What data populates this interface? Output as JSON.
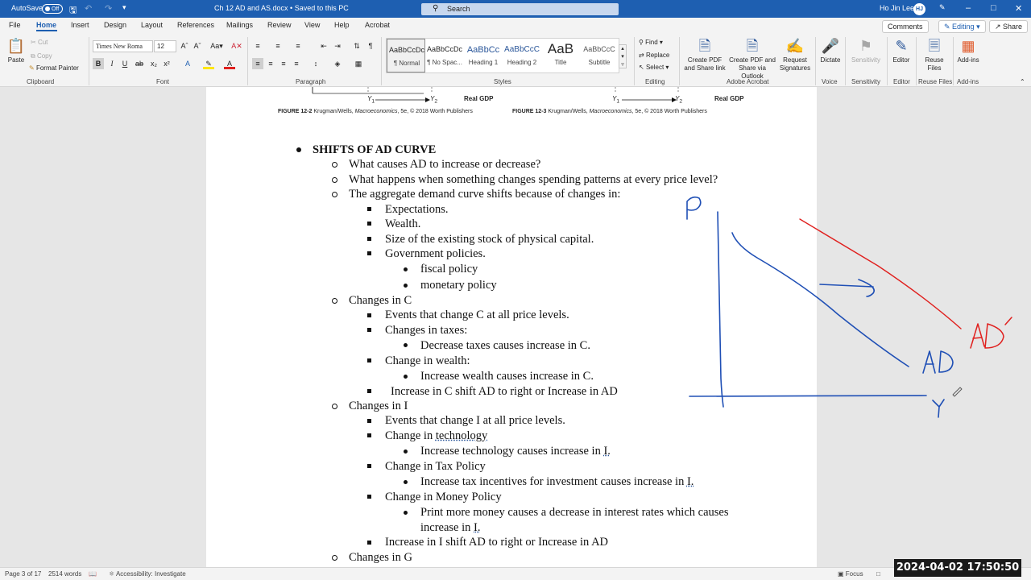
{
  "titlebar": {
    "autosave_label": "AutoSave",
    "autosave_state": "Off",
    "doc_title": "Ch 12 AD and AS.docx • Saved to this PC",
    "search_placeholder": "Search",
    "user_name": "Ho Jin Lee",
    "user_initials": "HJ",
    "icons": [
      "save-icon",
      "undo-icon",
      "redo-icon",
      "customize-icon",
      "minimize-icon",
      "maximize-icon",
      "close-icon"
    ]
  },
  "tabs": [
    "File",
    "Home",
    "Insert",
    "Design",
    "Layout",
    "References",
    "Mailings",
    "Review",
    "View",
    "Help",
    "Acrobat"
  ],
  "active_tab": "Home",
  "top_right": {
    "comments": "Comments",
    "editing": "Editing",
    "share": "Share"
  },
  "ribbon": {
    "clipboard": {
      "paste": "Paste",
      "cut": "Cut",
      "copy": "Copy",
      "format_painter": "Format Painter",
      "label": "Clipboard"
    },
    "font": {
      "name": "Times New Roma",
      "size": "12",
      "label": "Font"
    },
    "paragraph": {
      "label": "Paragraph"
    },
    "styles": {
      "items": [
        {
          "preview": "AaBbCcDc",
          "name": "¶ Normal"
        },
        {
          "preview": "AaBbCcDc",
          "name": "¶ No Spac..."
        },
        {
          "preview": "AaBbCc",
          "name": "Heading 1"
        },
        {
          "preview": "AaBbCcC",
          "name": "Heading 2"
        },
        {
          "preview": "AaB",
          "name": "Title"
        },
        {
          "preview": "AaBbCcC",
          "name": "Subtitle"
        }
      ],
      "label": "Styles"
    },
    "editing": {
      "find": "Find",
      "replace": "Replace",
      "select": "Select",
      "label": "Editing"
    },
    "acrobat": {
      "create_share": "Create PDF and Share link",
      "create_outlook": "Create PDF and Share via Outlook",
      "request_sig": "Request Signatures",
      "label": "Adobe Acrobat"
    },
    "voice": {
      "dictate": "Dictate",
      "label": "Voice"
    },
    "sensitivity": {
      "btn": "Sensitivity",
      "label": "Sensitivity"
    },
    "editor": {
      "btn": "Editor",
      "label": "Editor"
    },
    "reuse": {
      "btn": "Reuse Files",
      "label": "Reuse Files"
    },
    "addins": {
      "btn": "Add-ins",
      "label": "Add-ins"
    }
  },
  "document": {
    "fig_left": {
      "title": "FIGURE 12-2",
      "src": "Krugman/Wells,",
      "book": "Macroeconomics",
      "rest": ", 5e, © 2018 Worth Publishers",
      "y1": "Y",
      "y2": "Y",
      "axis": "Real GDP"
    },
    "fig_right": {
      "title": "FIGURE 12-3",
      "src": "Krugman/Wells,",
      "book": "Macroeconomics",
      "rest": ", 5e, © 2018 Worth Publishers",
      "y1": "Y",
      "y2": "Y",
      "axis": "Real GDP"
    },
    "lines": [
      "SHIFTS OF AD CURVE",
      "What causes AD to increase or decrease?",
      "What happens when something changes spending patterns at every price level?",
      "The aggregate demand curve shifts because of changes in:",
      "Expectations.",
      "Wealth.",
      "Size of the existing stock of physical capital.",
      "Government policies.",
      "fiscal policy",
      "monetary policy",
      "Changes in C",
      "Events that change C at all price levels.",
      "Changes in taxes:",
      "Decrease taxes causes increase in C.",
      "Change in wealth:",
      "Increase wealth causes increase in C.",
      "Increase in C shift AD to right or Increase in AD",
      "Changes in I",
      "Events that change I at all price levels.",
      "Change in ",
      "technology",
      "Increase technology causes increase in ",
      "I.",
      "Change in Tax Policy",
      "Increase tax incentives for investment causes increase in ",
      "I.",
      "Change in Money Policy",
      "Print more money causes a decrease in interest rates which causes",
      "increase in ",
      "I.",
      "Increase in I shift AD to right or Increase in AD",
      "Changes in G"
    ]
  },
  "ink": {
    "label_p": "P",
    "label_ad": "AD",
    "label_ad2": "AD'",
    "label_y": "Y",
    "blue": "#1f4fb5",
    "red": "#e0201e"
  },
  "status": {
    "page": "Page 3 of 17",
    "words": "2514 words",
    "accessibility": "Accessibility: Investigate",
    "focus": "Focus"
  },
  "clock": "2024-04-02  17:50:50"
}
